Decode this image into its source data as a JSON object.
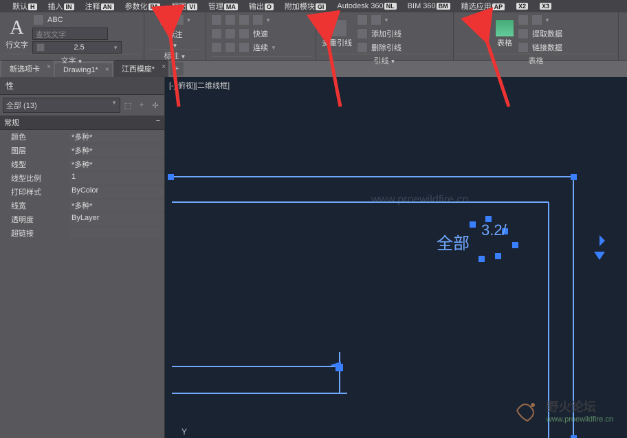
{
  "menu_tabs": [
    {
      "label": "默认",
      "key": "H"
    },
    {
      "label": "插入",
      "key": "IN"
    },
    {
      "label": "注释",
      "key": "AN"
    },
    {
      "label": "参数化",
      "key": "PA"
    },
    {
      "label": "视图",
      "key": "VI"
    },
    {
      "label": "管理",
      "key": "MA"
    },
    {
      "label": "输出",
      "key": "O"
    },
    {
      "label": "附加模块",
      "key": "GI"
    },
    {
      "label": "Autodesk 360",
      "key": "NL"
    },
    {
      "label": "BIM 360",
      "key": "BM"
    },
    {
      "label": "精选应用",
      "key": "AP"
    },
    {
      "label": "",
      "key": "X2"
    },
    {
      "label": "",
      "key": "X3"
    }
  ],
  "ribbon": {
    "text_panel": {
      "title": "文字",
      "row_text": "行文字",
      "placeholder": "查找文字",
      "size": "2.5"
    },
    "dim_panel": {
      "title": "标注",
      "sub": "标注"
    },
    "misc_panel": {
      "quick": "快速",
      "continuous": "连续"
    },
    "leader_panel": {
      "title": "引线",
      "multi": "多重引线",
      "add": "添加引线",
      "remove": "删除引线"
    },
    "table_panel": {
      "title": "表格",
      "table": "表格",
      "extract": "提取数据",
      "link": "链接数据"
    }
  },
  "doc_tabs": [
    {
      "label": "新选项卡",
      "active": false
    },
    {
      "label": "Drawing1*",
      "active": false
    },
    {
      "label": "江西模座*",
      "active": true
    }
  ],
  "properties": {
    "title": "性",
    "selector": "全部 (13)",
    "section": "常规",
    "rows": [
      {
        "key": "颜色",
        "val": "*多种*"
      },
      {
        "key": "图层",
        "val": "*多种*"
      },
      {
        "key": "线型",
        "val": "*多种*"
      },
      {
        "key": "线型比例",
        "val": "1"
      },
      {
        "key": "打印样式",
        "val": "ByColor"
      },
      {
        "key": "线宽",
        "val": "*多种*"
      },
      {
        "key": "透明度",
        "val": "ByLayer"
      },
      {
        "key": "超链接",
        "val": ""
      }
    ]
  },
  "viewport": "[-][俯视][二维线框]",
  "canvas_text": {
    "text1": "全部",
    "text2": "3.2/"
  },
  "watermark": {
    "name": "野火论坛",
    "url": "www.proewildfire.cn"
  },
  "canvas_wm": "www.proewildfire.cn"
}
